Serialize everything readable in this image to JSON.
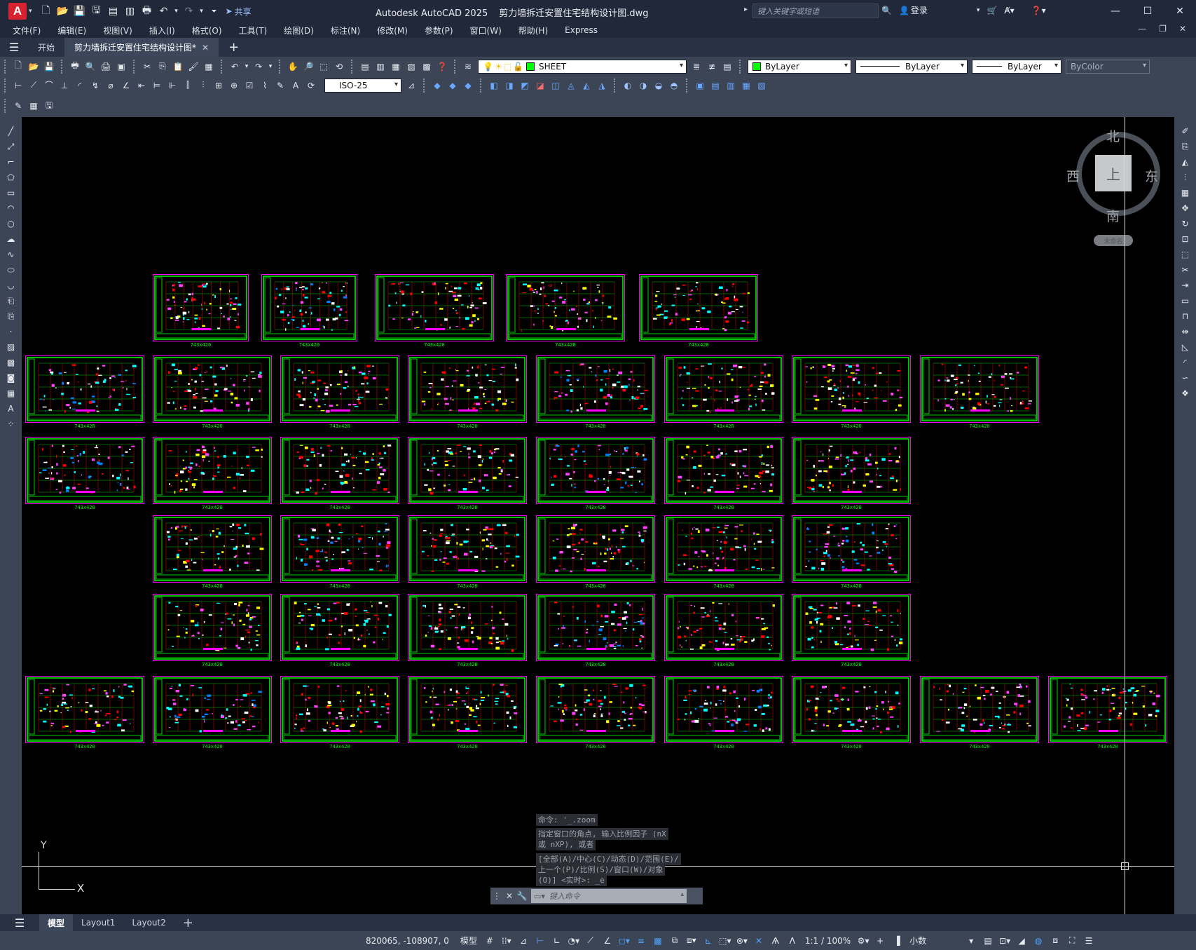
{
  "titlebar": {
    "app_logo": "A",
    "share_label": "共享",
    "app_name": "Autodesk AutoCAD 2025",
    "file_name": "剪力墙拆迁安置住宅结构设计图.dwg",
    "search_placeholder": "键入关键字或短语",
    "login_label": "登录"
  },
  "menu": [
    "文件(F)",
    "编辑(E)",
    "视图(V)",
    "插入(I)",
    "格式(O)",
    "工具(T)",
    "绘图(D)",
    "标注(N)",
    "修改(M)",
    "参数(P)",
    "窗口(W)",
    "帮助(H)",
    "Express"
  ],
  "tabs": {
    "start": "开始",
    "active": "剪力墙拆迁安置住宅结构设计图*"
  },
  "toolbar": {
    "layer_name": "SHEET",
    "color": "ByLayer",
    "linetype": "ByLayer",
    "lineweight": "ByLayer",
    "plotstyle": "ByColor",
    "dim_style": "ISO-25"
  },
  "viewcube": {
    "north": "北",
    "south": "南",
    "east": "东",
    "west": "西",
    "face": "上",
    "wcs": "未命名"
  },
  "ucs": {
    "x": "X",
    "y": "Y"
  },
  "sheet_label": "743x420",
  "command": {
    "line1": "命令: '_.zoom",
    "line2a": "指定窗口的角点, 输入比例因子 (nX",
    "line2b": "或 nXP), 或者",
    "line3a": "[全部(A)/中心(C)/动态(D)/范围(E)/",
    "line3b": "上一个(P)/比例(S)/窗口(W)/对象",
    "line3c": "(O)] <实时>: _e",
    "placeholder": "键入命令"
  },
  "layouts": [
    "模型",
    "Layout1",
    "Layout2"
  ],
  "status": {
    "coords": "820065, -108907, 0",
    "model": "模型",
    "scale": "1:1 / 100%",
    "units": "小数"
  },
  "colors": {
    "frame_green": "#00ff00",
    "frame_magenta": "#ff00ff",
    "canvas": "#000000",
    "ui_dark": "#20283a",
    "toolbar": "#3b4556"
  }
}
